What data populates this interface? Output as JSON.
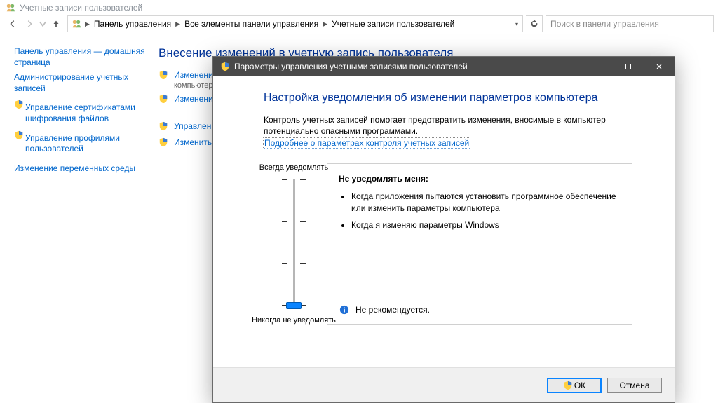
{
  "cp_header": {
    "title": "Учетные записи пользователей"
  },
  "breadcrumb": {
    "items": [
      "Панель управления",
      "Все элементы панели управления",
      "Учетные записи пользователей"
    ]
  },
  "search": {
    "placeholder": "Поиск в панели управления"
  },
  "sidebar": {
    "items": [
      {
        "label": "Панель управления — домашняя страница"
      },
      {
        "label": "Администрирование учетных записей"
      },
      {
        "label": "Управление сертификатами шифрования файлов",
        "shield": true
      },
      {
        "label": "Управление профилями пользователей",
        "shield": true
      },
      {
        "label": "Изменение переменных среды"
      }
    ]
  },
  "main": {
    "heading": "Внесение изменений в учетную запись пользователя",
    "actions": [
      {
        "label": "Изменение",
        "sub": "компьютера",
        "shield": true
      },
      {
        "label": "Изменение",
        "shield": true
      },
      {
        "label": "Управление",
        "shield": true
      },
      {
        "label": "Изменить п",
        "shield": true
      }
    ]
  },
  "uac": {
    "title": "Параметры управления учетными записями пользователей",
    "heading": "Настройка уведомления об изменении параметров компьютера",
    "desc": "Контроль учетных записей помогает предотвратить изменения, вносимые в компьютер потенциально опасными программами.",
    "learn_more": "Подробнее о параметрах контроля учетных записей",
    "slider": {
      "top_label": "Всегда уведомлять",
      "bottom_label": "Никогда не уведомлять",
      "level": 0,
      "levels_total": 4
    },
    "setting": {
      "title": "Не уведомлять меня:",
      "bullets": [
        "Когда приложения пытаются установить программное обеспечение или изменить параметры компьютера",
        "Когда я изменяю параметры Windows"
      ],
      "note": "Не рекомендуется."
    },
    "buttons": {
      "ok": "ОК",
      "cancel": "Отмена"
    }
  }
}
